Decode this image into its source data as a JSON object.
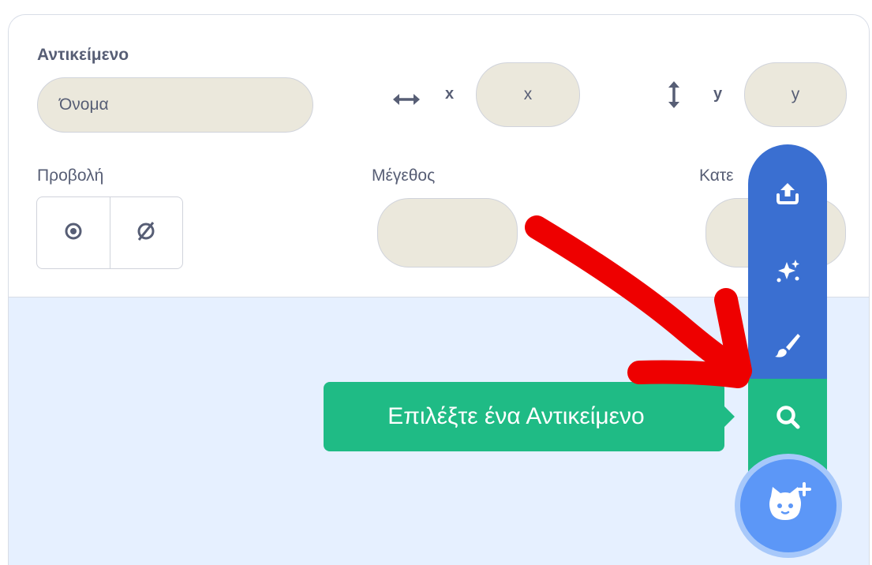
{
  "sprite_info": {
    "sprite_label": "Αντικείμενο",
    "name_placeholder": "Όνομα",
    "x_label": "x",
    "x_placeholder": "x",
    "y_label": "y",
    "y_placeholder": "y",
    "show_label": "Προβολή",
    "size_label": "Μέγεθος",
    "direction_label": "Κατε"
  },
  "sprite_menu": {
    "items": [
      {
        "name": "upload-sprite",
        "icon": "upload-icon"
      },
      {
        "name": "surprise",
        "icon": "sparkle-icon"
      },
      {
        "name": "paint",
        "icon": "paintbrush-icon"
      },
      {
        "name": "choose-sprite",
        "icon": "search-icon",
        "active": true
      }
    ],
    "tooltip": "Επιλέξτε ένα Αντικείμενο",
    "main_icon": "cat-plus-icon"
  },
  "colors": {
    "menu_blue": "#3a6fd1",
    "active_green": "#1fbb85",
    "button_blue": "#5c97f7",
    "annotation_red": "#ee0000",
    "panel_bg": "#e6f0ff"
  }
}
